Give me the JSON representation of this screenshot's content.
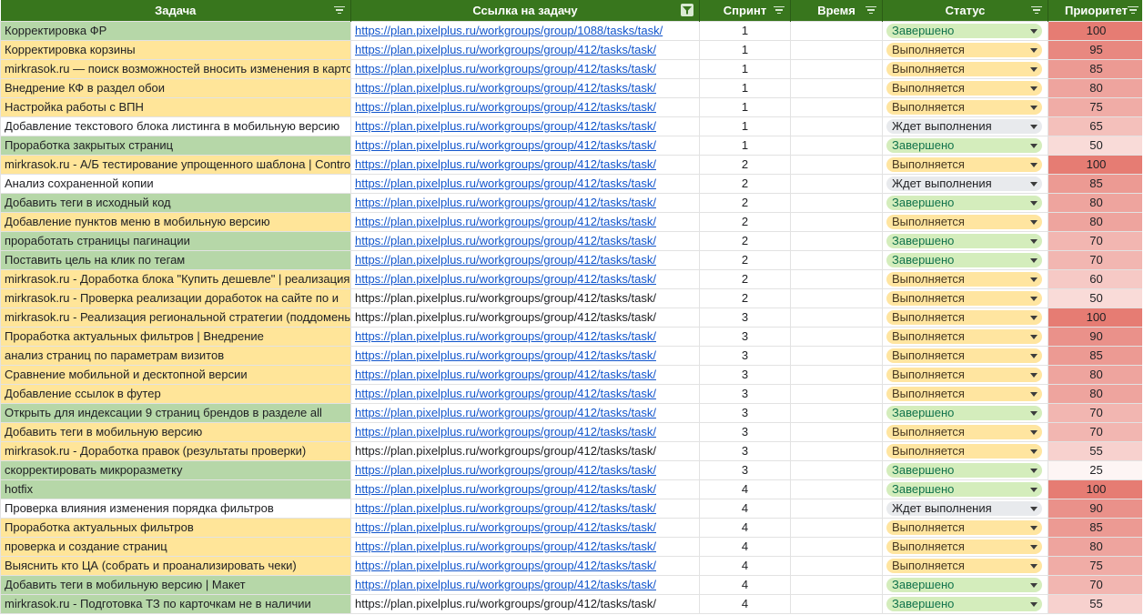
{
  "columns": {
    "task": "Задача",
    "link": "Ссылка на задачу",
    "sprint": "Спринт",
    "time": "Время",
    "status": "Статус",
    "priority": "Приоритет"
  },
  "icons": {
    "filter": "filter-lines-icon",
    "active_filter": "funnel-icon",
    "dropdown": "caret-down-icon"
  },
  "colors": {
    "header_bg": "#38761d",
    "done_row": "#b6d7a8",
    "progress_row": "#ffe599",
    "link": "#1155cc",
    "priority_high": "#e67c73"
  },
  "rows": [
    {
      "task": "Корректировка ФР",
      "link": "https://plan.pixelplus.ru/workgroups/group/1088/tasks/task/",
      "linked": true,
      "sprint": "1",
      "time": "",
      "status": "Завершено",
      "status_key": "done",
      "priority": "100"
    },
    {
      "task": "Корректировка корзины",
      "link": "https://plan.pixelplus.ru/workgroups/group/412/tasks/task/",
      "linked": true,
      "sprint": "1",
      "time": "",
      "status": "Выполняется",
      "status_key": "progress",
      "priority": "95"
    },
    {
      "task": "mirkrasok.ru — поиск возможностей вносить изменения в карточки",
      "link": "https://plan.pixelplus.ru/workgroups/group/412/tasks/task/",
      "linked": true,
      "sprint": "1",
      "time": "",
      "status": "Выполняется",
      "status_key": "progress",
      "priority": "85"
    },
    {
      "task": "Внедрение КФ в раздел обои",
      "link": "https://plan.pixelplus.ru/workgroups/group/412/tasks/task/",
      "linked": true,
      "sprint": "1",
      "time": "",
      "status": "Выполняется",
      "status_key": "progress",
      "priority": "80"
    },
    {
      "task": "Настройка работы с ВПН",
      "link": "https://plan.pixelplus.ru/workgroups/group/412/tasks/task/",
      "linked": true,
      "sprint": "1",
      "time": "",
      "status": "Выполняется",
      "status_key": "progress",
      "priority": "75"
    },
    {
      "task": "Добавление текстового блока листинга в мобильную версию",
      "link": "https://plan.pixelplus.ru/workgroups/group/412/tasks/task/",
      "linked": true,
      "sprint": "1",
      "time": "",
      "status": "Ждет выполнения",
      "status_key": "waiting",
      "priority": "65"
    },
    {
      "task": "Проработка закрытых страниц",
      "link": "https://plan.pixelplus.ru/workgroups/group/412/tasks/task/",
      "linked": true,
      "sprint": "1",
      "time": "",
      "status": "Завершено",
      "status_key": "done",
      "priority": "50"
    },
    {
      "task": "mirkrasok.ru - А/Б тестирование упрощенного шаблона | Contro",
      "link": "https://plan.pixelplus.ru/workgroups/group/412/tasks/task/",
      "linked": true,
      "sprint": "2",
      "time": "",
      "status": "Выполняется",
      "status_key": "progress",
      "priority": "100"
    },
    {
      "task": "Анализ сохраненной копии",
      "link": "https://plan.pixelplus.ru/workgroups/group/412/tasks/task/",
      "linked": true,
      "sprint": "2",
      "time": "",
      "status": "Ждет выполнения",
      "status_key": "waiting",
      "priority": "85"
    },
    {
      "task": "Добавить теги в исходный код",
      "link": "https://plan.pixelplus.ru/workgroups/group/412/tasks/task/",
      "linked": true,
      "sprint": "2",
      "time": "",
      "status": "Завершено",
      "status_key": "done",
      "priority": "80"
    },
    {
      "task": "Добавление пунктов меню в мобильную версию",
      "link": "https://plan.pixelplus.ru/workgroups/group/412/tasks/task/",
      "linked": true,
      "sprint": "2",
      "time": "",
      "status": "Выполняется",
      "status_key": "progress",
      "priority": "80"
    },
    {
      "task": "проработать страницы пагинации",
      "link": "https://plan.pixelplus.ru/workgroups/group/412/tasks/task/",
      "linked": true,
      "sprint": "2",
      "time": "",
      "status": "Завершено",
      "status_key": "done",
      "priority": "70"
    },
    {
      "task": "Поставить цель на клик по тегам",
      "link": "https://plan.pixelplus.ru/workgroups/group/412/tasks/task/",
      "linked": true,
      "sprint": "2",
      "time": "",
      "status": "Завершено",
      "status_key": "done",
      "priority": "70"
    },
    {
      "task": "mirkrasok.ru - Доработка блока \"Купить дешевле\" | реализация",
      "link": "https://plan.pixelplus.ru/workgroups/group/412/tasks/task/",
      "linked": true,
      "sprint": "2",
      "time": "",
      "status": "Выполняется",
      "status_key": "progress",
      "priority": "60"
    },
    {
      "task": "mirkrasok.ru - Проверка реализации доработок на сайте по и",
      "link": "https://plan.pixelplus.ru/workgroups/group/412/tasks/task/",
      "linked": false,
      "sprint": "2",
      "time": "",
      "status": "Выполняется",
      "status_key": "progress",
      "priority": "50"
    },
    {
      "task": "mirkrasok.ru - Реализация региональной стратегии (поддомены)",
      "link": "https://plan.pixelplus.ru/workgroups/group/412/tasks/task/",
      "linked": false,
      "sprint": "3",
      "time": "",
      "status": "Выполняется",
      "status_key": "progress",
      "priority": "100"
    },
    {
      "task": "Проработка актуальных фильтров | Внедрение",
      "link": "https://plan.pixelplus.ru/workgroups/group/412/tasks/task/",
      "linked": true,
      "sprint": "3",
      "time": "",
      "status": "Выполняется",
      "status_key": "progress",
      "priority": "90"
    },
    {
      "task": "анализ страниц по параметрам визитов",
      "link": "https://plan.pixelplus.ru/workgroups/group/412/tasks/task/",
      "linked": true,
      "sprint": "3",
      "time": "",
      "status": "Выполняется",
      "status_key": "progress",
      "priority": "85"
    },
    {
      "task": "Сравнение мобильной и десктопной версии",
      "link": "https://plan.pixelplus.ru/workgroups/group/412/tasks/task/",
      "linked": true,
      "sprint": "3",
      "time": "",
      "status": "Выполняется",
      "status_key": "progress",
      "priority": "80"
    },
    {
      "task": "Добавление ссылок в футер",
      "link": "https://plan.pixelplus.ru/workgroups/group/412/tasks/task/",
      "linked": true,
      "sprint": "3",
      "time": "",
      "status": "Выполняется",
      "status_key": "progress",
      "priority": "80"
    },
    {
      "task": "Открыть для индексации 9 страниц брендов в разделе all",
      "link": "https://plan.pixelplus.ru/workgroups/group/412/tasks/task/",
      "linked": true,
      "sprint": "3",
      "time": "",
      "status": "Завершено",
      "status_key": "done",
      "priority": "70"
    },
    {
      "task": "Добавить теги в мобильную версию",
      "link": "https://plan.pixelplus.ru/workgroups/group/412/tasks/task/",
      "linked": true,
      "sprint": "3",
      "time": "",
      "status": "Выполняется",
      "status_key": "progress",
      "priority": "70"
    },
    {
      "task": "mirkrasok.ru - Доработка правок (результаты проверки)",
      "link": "https://plan.pixelplus.ru/workgroups/group/412/tasks/task/",
      "linked": false,
      "sprint": "3",
      "time": "",
      "status": "Выполняется",
      "status_key": "progress",
      "priority": "55"
    },
    {
      "task": "скорректировать микроразметку",
      "link": "https://plan.pixelplus.ru/workgroups/group/412/tasks/task/",
      "linked": true,
      "sprint": "3",
      "time": "",
      "status": "Завершено",
      "status_key": "done",
      "priority": "25"
    },
    {
      "task": "hotfix",
      "link": "https://plan.pixelplus.ru/workgroups/group/412/tasks/task/",
      "linked": true,
      "sprint": "4",
      "time": "",
      "status": "Завершено",
      "status_key": "done",
      "priority": "100"
    },
    {
      "task": "Проверка влияния изменения порядка фильтров",
      "link": "https://plan.pixelplus.ru/workgroups/group/412/tasks/task/",
      "linked": true,
      "sprint": "4",
      "time": "",
      "status": "Ждет выполнения",
      "status_key": "waiting",
      "priority": "90"
    },
    {
      "task": "Проработка актуальных фильтров",
      "link": "https://plan.pixelplus.ru/workgroups/group/412/tasks/task/",
      "linked": true,
      "sprint": "4",
      "time": "",
      "status": "Выполняется",
      "status_key": "progress",
      "priority": "85"
    },
    {
      "task": "проверка и создание страниц",
      "link": "https://plan.pixelplus.ru/workgroups/group/412/tasks/task/",
      "linked": true,
      "sprint": "4",
      "time": "",
      "status": "Выполняется",
      "status_key": "progress",
      "priority": "80"
    },
    {
      "task": "Выяснить кто ЦА (собрать и проанализировать чеки)",
      "link": "https://plan.pixelplus.ru/workgroups/group/412/tasks/task/",
      "linked": true,
      "sprint": "4",
      "time": "",
      "status": "Выполняется",
      "status_key": "progress",
      "priority": "75"
    },
    {
      "task": "Добавить теги в мобильную версию | Макет",
      "link": "https://plan.pixelplus.ru/workgroups/group/412/tasks/task/",
      "linked": true,
      "sprint": "4",
      "time": "",
      "status": "Завершено",
      "status_key": "done",
      "priority": "70"
    },
    {
      "task": "mirkrasok.ru - Подготовка ТЗ по карточкам не в наличии",
      "link": "https://plan.pixelplus.ru/workgroups/group/412/tasks/task/",
      "linked": false,
      "sprint": "4",
      "time": "",
      "status": "Завершено",
      "status_key": "done",
      "priority": "55"
    }
  ]
}
